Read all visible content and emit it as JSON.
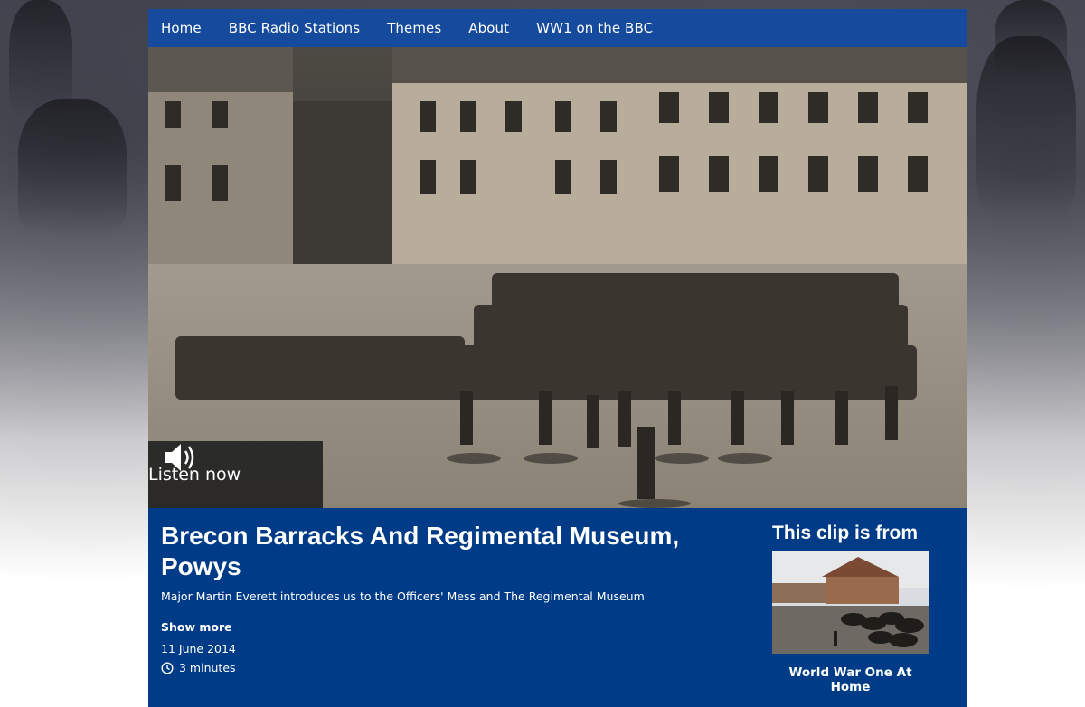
{
  "nav": {
    "items": [
      "Home",
      "BBC Radio Stations",
      "Themes",
      "About",
      "WW1 on the BBC"
    ]
  },
  "hero": {
    "listen_label": "Listen now"
  },
  "clip": {
    "title": "Brecon Barracks And Regimental Museum, Powys",
    "description": "Major Martin Everett introduces us to the Officers' Mess and The Regimental Museum",
    "show_more": "Show more",
    "date": "11 June 2014",
    "duration": "3 minutes"
  },
  "from": {
    "heading": "This clip is from",
    "programme_title": "World War One At Home"
  },
  "colors": {
    "nav_bg": "#154a9d",
    "panel_bg": "#003b87",
    "listen_bg": "#232323"
  },
  "icons": {
    "listen": "speaker-icon",
    "duration": "clock-icon"
  }
}
